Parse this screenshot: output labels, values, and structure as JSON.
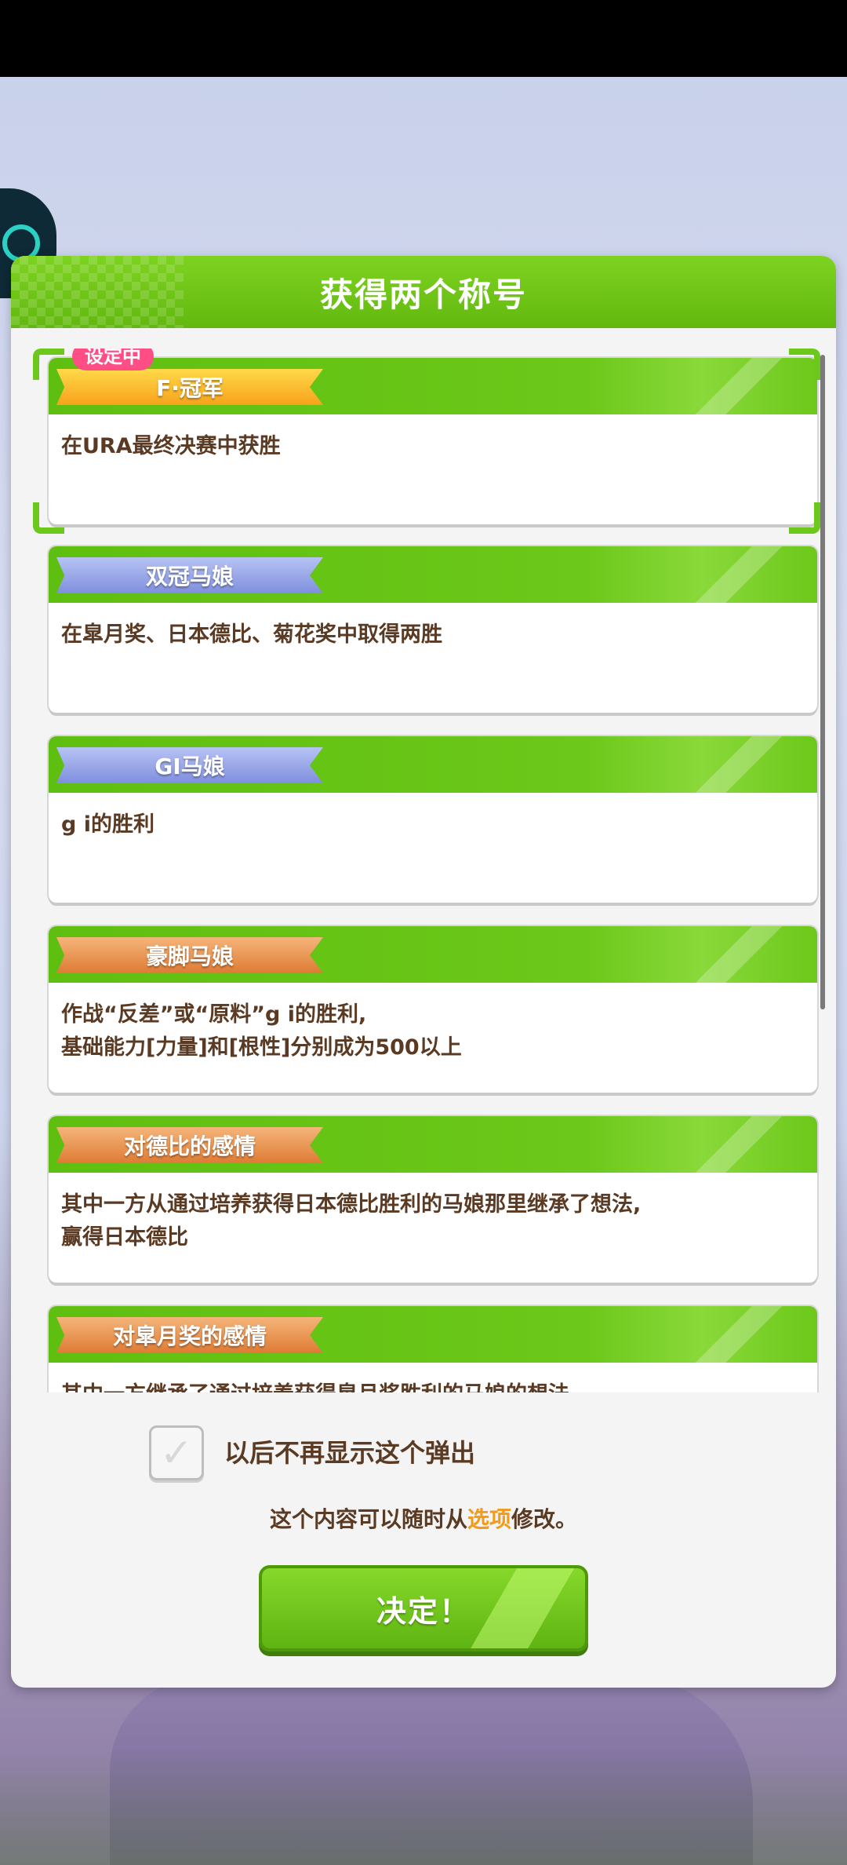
{
  "dialog": {
    "title": "获得两个称号",
    "current_badge": "设定中",
    "titles": [
      {
        "name": "F·冠军",
        "desc": "在URA最终决赛中获胜",
        "rank": "gold"
      },
      {
        "name": "双冠马娘",
        "desc": "在皐月奖、日本德比、菊花奖中取得两胜",
        "rank": "blue"
      },
      {
        "name": "GI马娘",
        "desc": "g i的胜利",
        "rank": "blue"
      },
      {
        "name": "豪脚马娘",
        "desc": "作战“反差”或“原料”g i的胜利,\n基础能力[力量]和[根性]分别成为500以上",
        "rank": "bronze"
      },
      {
        "name": "对德比的感情",
        "desc": "其中一方从通过培养获得日本德比胜利的马娘那里继承了想法,\n赢得日本德比",
        "rank": "bronze"
      },
      {
        "name": "对皐月奖的感情",
        "desc": "其中一方继承了通过培养获得皐月奖胜利的马娘的想法",
        "rank": "bronze"
      }
    ],
    "checkbox_label": "以后不再显示这个弹出",
    "hint_prefix": "这个内容可以随时从",
    "hint_link": "选项",
    "hint_suffix": "修改。",
    "confirm_label": "决定！"
  }
}
